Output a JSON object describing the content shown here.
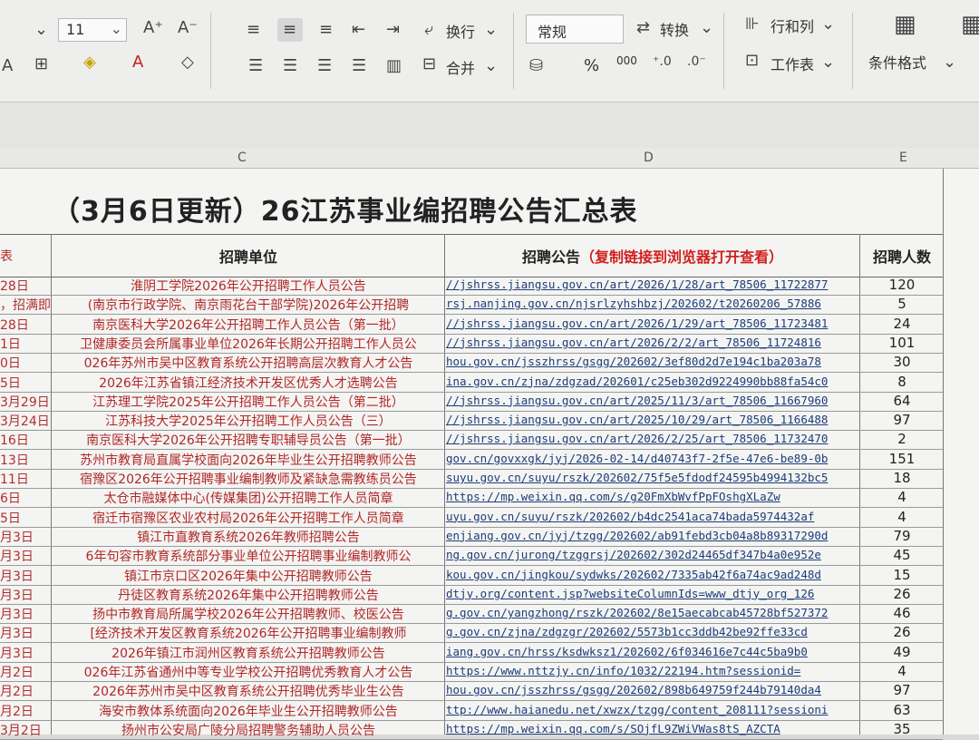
{
  "toolbar": {
    "font_size": "11",
    "wrap_label": "换行",
    "number_format": "常规",
    "convert_label": "转换",
    "rowcol_label": "行和列",
    "merge_label": "合并",
    "worksheet_label": "工作表",
    "condfmt_label": "条件格式",
    "percent": "%",
    "thousands": "000"
  },
  "columns": [
    "C",
    "D",
    "E"
  ],
  "sheet": {
    "title": "（3月6日更新）26江苏事业编招聘公告汇总表",
    "header_date": "表",
    "header_unit": "招聘单位",
    "header_notice": "招聘公告",
    "header_notice_note": "（复制链接到浏览器打开查看）",
    "header_count": "招聘人数",
    "rows": [
      {
        "date": "28日",
        "unit": "淮阴工学院2026年公开招聘工作人员公告",
        "url": "//jshrss.jiangsu.gov.cn/art/2026/1/28/art_78506_11722877",
        "count": "120"
      },
      {
        "date": "，招满即",
        "unit": "(南京市行政学院、南京雨花台干部学院)2026年公开招聘",
        "url": "rsj.nanjing.gov.cn/njsrlzyhshbzj/202602/t20260206_57886",
        "count": "5"
      },
      {
        "date": "28日",
        "unit": "南京医科大学2026年公开招聘工作人员公告（第一批）",
        "url": "//jshrss.jiangsu.gov.cn/art/2026/1/29/art_78506_11723481",
        "count": "24"
      },
      {
        "date": "1日",
        "unit": "卫健康委员会所属事业单位2026年长期公开招聘工作人员公",
        "url": "//jshrss.jiangsu.gov.cn/art/2026/2/2/art_78506_11724816",
        "count": "101"
      },
      {
        "date": "0日",
        "unit": "026年苏州市吴中区教育系统公开招聘高层次教育人才公告",
        "url": "hou.gov.cn/jsszhrss/gsgg/202602/3ef80d2d7e194c1ba203a78",
        "count": "30"
      },
      {
        "date": "5日",
        "unit": "2026年江苏省镇江经济技术开发区优秀人才选聘公告",
        "url": "ina.gov.cn/zjna/zdgzad/202601/c25eb302d9224990bb88fa54c0",
        "count": "8"
      },
      {
        "date": "3月29日",
        "unit": "江苏理工学院2025年公开招聘工作人员公告（第二批）",
        "url": "//jshrss.jiangsu.gov.cn/art/2025/11/3/art_78506_11667960",
        "count": "64"
      },
      {
        "date": "3月24日",
        "unit": "江苏科技大学2025年公开招聘工作人员公告（三）",
        "url": "//jshrss.jiangsu.gov.cn/art/2025/10/29/art_78506_1166488",
        "count": "97"
      },
      {
        "date": "16日",
        "unit": "南京医科大学2026年公开招聘专职辅导员公告（第一批）",
        "url": "//jshrss.jiangsu.gov.cn/art/2026/2/25/art_78506_11732470",
        "count": "2"
      },
      {
        "date": "13日",
        "unit": "苏州市教育局直属学校面向2026年毕业生公开招聘教师公告",
        "url": "gov.cn/govxxgk/jyj/2026-02-14/d40743f7-2f5e-47e6-be89-0b",
        "count": "151"
      },
      {
        "date": "11日",
        "unit": "宿豫区2026年公开招聘事业编制教师及紧缺急需教练员公告",
        "url": "suyu.gov.cn/suyu/rszk/202602/75f5e5fdodf24595b4994132bc5",
        "count": "18"
      },
      {
        "date": "6日",
        "unit": "太仓市融媒体中心(传媒集团)公开招聘工作人员简章",
        "url": "https://mp.weixin.qq.com/s/g20FmXbWvfPpFOshgXLaZw",
        "count": "4"
      },
      {
        "date": "5日",
        "unit": "宿迁市宿豫区农业农村局2026年公开招聘工作人员简章",
        "url": "uyu.gov.cn/suyu/rszk/202602/b4dc2541aca74bada5974432af",
        "count": "4"
      },
      {
        "date": "月3日",
        "unit": "镇江市直教育系统2026年教师招聘公告",
        "url": "enjiang.gov.cn/jyj/tzgg/202602/ab91febd3cb04a8b89317290d",
        "count": "79"
      },
      {
        "date": "月3日",
        "unit": "6年句容市教育系统部分事业单位公开招聘事业编制教师公",
        "url": "ng.gov.cn/jurong/tzggrsj/202602/302d24465df347b4a0e952e",
        "count": "45"
      },
      {
        "date": "月3日",
        "unit": "镇江市京口区2026年集中公开招聘教师公告",
        "url": "kou.gov.cn/jingkou/sydwks/202602/7335ab42f6a74ac9ad248d",
        "count": "15"
      },
      {
        "date": "月3日",
        "unit": "丹徒区教育系统2026年集中公开招聘教师公告",
        "url": "dtjy.org/content.jsp?websiteColumnIds=www_dtjy_org_126",
        "count": "26"
      },
      {
        "date": "月3日",
        "unit": "扬中市教育局所属学校2026年公开招聘教师、校医公告",
        "url": "g.gov.cn/yangzhong/rszk/202602/8e15aecabcab45728bf527372",
        "count": "46"
      },
      {
        "date": "月3日",
        "unit": "[经济技术开发区教育系统2026年公开招聘事业编制教师",
        "url": "g.gov.cn/zjna/zdgzgr/202602/5573b1cc3ddb42be92ffe33cd",
        "count": "26"
      },
      {
        "date": "月3日",
        "unit": "2026年镇江市润州区教育系统公开招聘教师公告",
        "url": "iang.gov.cn/hrss/ksdwksz1/202602/6f034616e7c44c5ba9b0",
        "count": "49"
      },
      {
        "date": "月2日",
        "unit": "026年江苏省通州中等专业学校公开招聘优秀教育人才公告",
        "url": "https://www.nttzjy.cn/info/1032/22194.htm?sessionid=",
        "count": "4"
      },
      {
        "date": "月2日",
        "unit": "2026年苏州市吴中区教育系统公开招聘优秀毕业生公告",
        "url": "hou.gov.cn/jsszhrss/gsgg/202602/898b649759f244b79140da4",
        "count": "97"
      },
      {
        "date": "月2日",
        "unit": "海安市教体系统面向2026年毕业生公开招聘教师公告",
        "url": "ttp://www.haianedu.net/xwzx/tzgg/content_208111?sessioni",
        "count": "63"
      },
      {
        "date": "3月2日",
        "unit": "扬州市公安局广陵分局招聘警务辅助人员公告",
        "url": "https://mp.weixin.qq.com/s/SOjfL9ZWiVWas8tS_AZCTA",
        "count": "35"
      }
    ]
  }
}
